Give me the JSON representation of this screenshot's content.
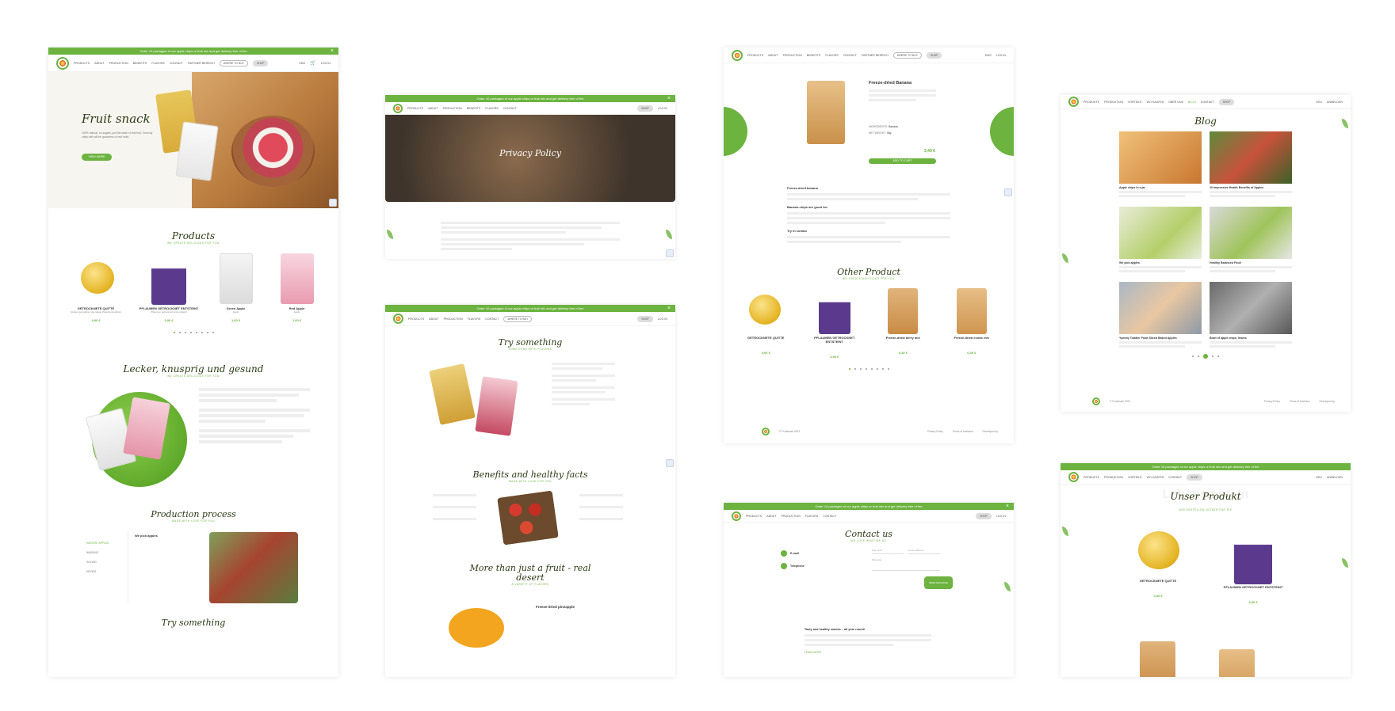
{
  "nav": {
    "items": [
      "PRODUCTS",
      "ABOUT",
      "PRODUCTION",
      "BENEFITS",
      "FLAVORS",
      "CONTACT",
      "PARTNER BEREICH"
    ],
    "where_to_buy": "WHERE TO BUY",
    "shop": "SHOP",
    "lang": "ENG",
    "login": "LOG IN"
  },
  "nav_de": {
    "items": [
      "PRODUKTE",
      "PRODUKTION",
      "VORTEILE",
      "WO KAUFEN",
      "ÜBER UNS",
      "BLOG",
      "KONTAKT"
    ],
    "shop": "SHOP",
    "lang": "DEU",
    "login": "ANMELDEN"
  },
  "promo": "Order 10 packages of our apple chips or fruit mix and get delivery free of fee",
  "home": {
    "hero_title": "Fruit snack",
    "hero_text": "100% natural, no sugars, just the taste of real fruit. Crunchy chips with all the goodness of real fruits.",
    "hero_btn": "VIEW MORE",
    "products_title": "Products",
    "products_sub": "WE CREATE DELICIOUS FOR YOU",
    "products": [
      {
        "name": "GETROCKNETE QUITTE",
        "desc": "Quitten getrocknet, die ideale Zwischenmahlzeit",
        "price": "4,90 €"
      },
      {
        "name": "PFLAUMEN GETROCKNET ENTSTEINT",
        "desc": "Pflaumen getrocknet und entsteint",
        "price": "3,90 €"
      },
      {
        "name": "Green Apple",
        "desc": "Apple",
        "price": "1,60 €"
      },
      {
        "name": "Red Apple",
        "desc": "Apple",
        "price": "1,60 €"
      }
    ],
    "lecker_title": "Lecker, knusprig und gesund",
    "lecker_sub": "WE CREATE DELICIOUS FOR YOU",
    "production_title": "Production process",
    "production_sub": "MADE WITH LOVE FOR YOU",
    "production_steps": [
      "HARVEST APPLES",
      "WASHING",
      "SLICING",
      "DRYING"
    ],
    "production_active": "We pick apples",
    "try_title": "Try something"
  },
  "privacy": {
    "title": "Privacy Policy"
  },
  "flavors": {
    "try_title": "Try something",
    "try_sub": "SOMETHING WITH FLAVORS",
    "benefits_title": "Benefits and healthy facts",
    "benefits_sub": "MADE WITH LOVE FOR YOU",
    "more_title": "More than just a fruit - real desert",
    "more_sub": "A VARIETY OF FLAVORS",
    "pineapple": "Freeze-dried pineapple"
  },
  "product_page": {
    "title": "Freeze-dried Banana",
    "ingredients_label": "INGREDIENTS:",
    "ingredients": "Banana",
    "net_weight_label": "NET WEIGHT:",
    "net_weight": "30g",
    "price": "3,49 €",
    "add_to_cart": "ADD TO CART",
    "desc_title": "Freeze-dried banana",
    "good_for": "Banana chips are good for:",
    "combo": "Try in combo",
    "other_title": "Other Product",
    "other_sub": "WE CREATE DELICIOUS FOR YOU",
    "other": [
      {
        "name": "GETROCKNETE QUITTE",
        "price": "4,90 €"
      },
      {
        "name": "PFLAUMEN GETROCKNET ENTSTEINT",
        "price": "3,90 €"
      },
      {
        "name": "Freeze-dried berry mix",
        "price": "6,49 €"
      },
      {
        "name": "Freeze-dried exotic mix",
        "price": "6,49 €"
      }
    ]
  },
  "contact": {
    "title": "Contact us",
    "sub": "WE LOVE WHAT WE DO",
    "email_label": "E-mail",
    "phone_label": "Telephone",
    "name_ph": "Full name",
    "email_ph": "Email address",
    "message_ph": "Message",
    "send": "SEND MESSAGE",
    "tasty": "Tasty and healthy snacks – all year round!",
    "learn": "LEARN MORE"
  },
  "blog": {
    "title": "Blog",
    "posts": [
      {
        "title": "Apple chips in a jar"
      },
      {
        "title": "10 Impressive Health Benefits of Apples"
      },
      {
        "title": "We pick apples"
      },
      {
        "title": "Healthy Balanced Food"
      },
      {
        "title": "Yummy Toddler Food Sliced Baked Apples"
      },
      {
        "title": "Bowl of apple chips, leaves"
      }
    ]
  },
  "produkt": {
    "title": "Unser Produkt",
    "ghost": "Lebensmitteln",
    "sub": "WIR ERSTELLEN LECKER FÜR SIE",
    "items": [
      {
        "name": "GETROCKNETE QUITTE",
        "price": "4,90 €"
      },
      {
        "name": "PFLAUMEN GETROCKNET ENTSTEINT",
        "price": "3,90 €"
      }
    ]
  },
  "footer": {
    "copyright": "© Fruitsnack 2023",
    "privacy": "Privacy Policy",
    "terms": "Terms of business",
    "developed": "Developed by"
  }
}
